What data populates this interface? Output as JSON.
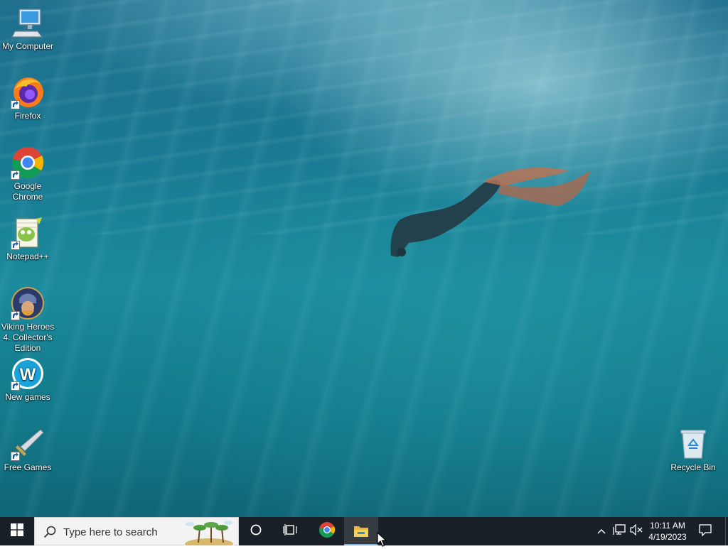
{
  "desktop": {
    "icons": [
      {
        "label": "My Computer",
        "icon": "my-computer-icon"
      },
      {
        "label": "Firefox",
        "icon": "firefox-icon"
      },
      {
        "label": "Google Chrome",
        "icon": "chrome-icon"
      },
      {
        "label": "Notepad++",
        "icon": "notepad-plus-plus-icon"
      },
      {
        "label": "Viking Heroes 4. Collector's Edition",
        "icon": "viking-heroes-icon"
      },
      {
        "label": "New games",
        "icon": "new-games-icon"
      },
      {
        "label": "Free Games",
        "icon": "free-games-icon"
      },
      {
        "label": "Recycle Bin",
        "icon": "recycle-bin-icon"
      }
    ]
  },
  "taskbar": {
    "start_icon": "windows-start-icon",
    "search": {
      "placeholder": "Type here to search"
    },
    "cortana_icon": "cortana-circle-icon",
    "task_view_icon": "task-view-icon",
    "pinned": [
      {
        "name": "Google Chrome",
        "icon": "chrome-icon"
      },
      {
        "name": "File Explorer",
        "icon": "file-explorer-icon",
        "active": true
      }
    ],
    "tray": {
      "chevron_icon": "chevron-up-icon",
      "network_icon": "network-icon",
      "volume_icon": "volume-muted-icon",
      "time": "10:11 AM",
      "date": "4/19/2023",
      "notification_icon": "action-center-icon"
    }
  },
  "colors": {
    "taskbar": "#1a2027",
    "search_bg": "#f3f3f3",
    "desktop_water": "#1a8a9c"
  }
}
